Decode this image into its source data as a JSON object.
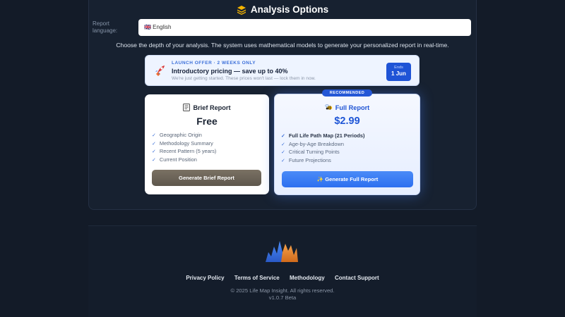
{
  "header": {
    "title": "Analysis Options",
    "icon": "layers-icon"
  },
  "language": {
    "label": "Report language:",
    "value": "🇬🇧 English"
  },
  "intro": "Choose the depth of your analysis. The system uses mathematical models to generate your personalized report in real-time.",
  "offer": {
    "tag": "LAUNCH OFFER · 2 WEEKS ONLY",
    "headline": "Introductory pricing — save up to 40%",
    "subtext": "We're just getting started. These prices won't last — lock them in now.",
    "ends_label": "Ends",
    "ends_value": "1 Jun",
    "icon": "rocket-icon"
  },
  "plans": {
    "brief": {
      "name": "Brief Report",
      "price": "Free",
      "icon": "document-icon",
      "features": [
        "Geographic Origin",
        "Methodology Summary",
        "Recent Pattern (5 years)",
        "Current Position"
      ],
      "button": "Generate Brief Report"
    },
    "full": {
      "badge": "RECOMMENDED",
      "name": "Full Report",
      "price": "$2.99",
      "icon": "bee-icon",
      "features": [
        "Full Life Path Map (21 Periods)",
        "Age-by-Age Breakdown",
        "Critical Turning Points",
        "Future Projections"
      ],
      "button": "✨ Generate Full Report"
    }
  },
  "footer": {
    "links": [
      "Privacy Policy",
      "Terms of Service",
      "Methodology",
      "Contact Support"
    ],
    "copyright": "© 2025 Life Map Insight. All rights reserved.",
    "version": "v1.0.7 Beta"
  },
  "colors": {
    "background": "#131b28",
    "accent": "#2457d6",
    "brief_button": "#6b6358"
  }
}
